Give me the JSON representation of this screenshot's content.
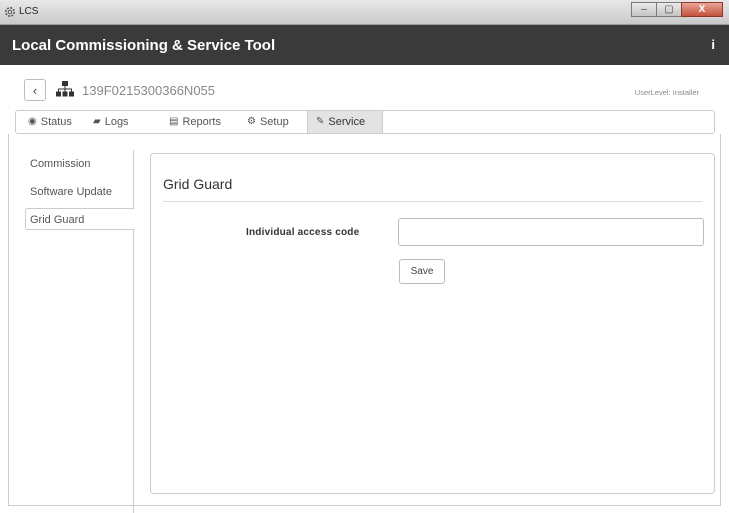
{
  "window": {
    "title": "LCS",
    "buttons": {
      "minimize": "–",
      "maximize": "▢",
      "close": "X"
    }
  },
  "header": {
    "title": "Local Commissioning & Service Tool",
    "info_label": "i"
  },
  "device": {
    "back_label": "‹",
    "serial": "139F0215300366N055",
    "user_level": "UserLevel: Installer"
  },
  "tabs": [
    {
      "label": "Status",
      "icon": "eye-icon"
    },
    {
      "label": "Logs",
      "icon": "book-icon"
    },
    {
      "label": "Reports",
      "icon": "report-icon"
    },
    {
      "label": "Setup",
      "icon": "gears-icon"
    },
    {
      "label": "Service",
      "icon": "wrench-icon",
      "active": true
    }
  ],
  "sidenav": {
    "items": [
      {
        "label": "Commission"
      },
      {
        "label": "Software Update"
      },
      {
        "label": "Grid Guard",
        "active": true
      }
    ]
  },
  "panel": {
    "title": "Grid Guard",
    "field_label": "Individual access code",
    "field_value": "",
    "field_placeholder": "",
    "save_label": "Save"
  }
}
